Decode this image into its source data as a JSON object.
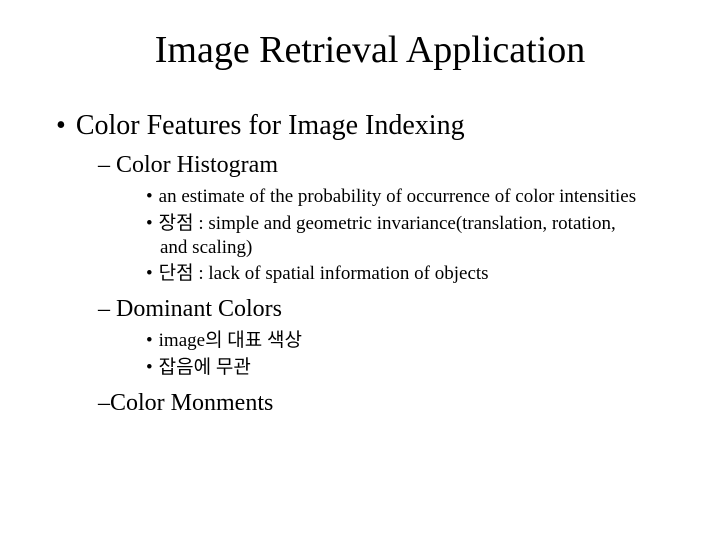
{
  "title": "Image Retrieval Application",
  "l1": {
    "item1": "Color Features for Image Indexing"
  },
  "l2": {
    "item1": "Color Histogram",
    "item2": "Dominant Colors",
    "item3": "Color Monments"
  },
  "l3": {
    "hist1": "an estimate of the probability of occurrence of color intensities",
    "hist2": "장점 : simple and geometric invariance(translation, rotation, and scaling)",
    "hist3": "단점 : lack of spatial information of objects",
    "dom1": "image의 대표 색상",
    "dom2": "잡음에 무관"
  },
  "bullets": {
    "disc": "•",
    "dash": "–",
    "dot": "•"
  }
}
